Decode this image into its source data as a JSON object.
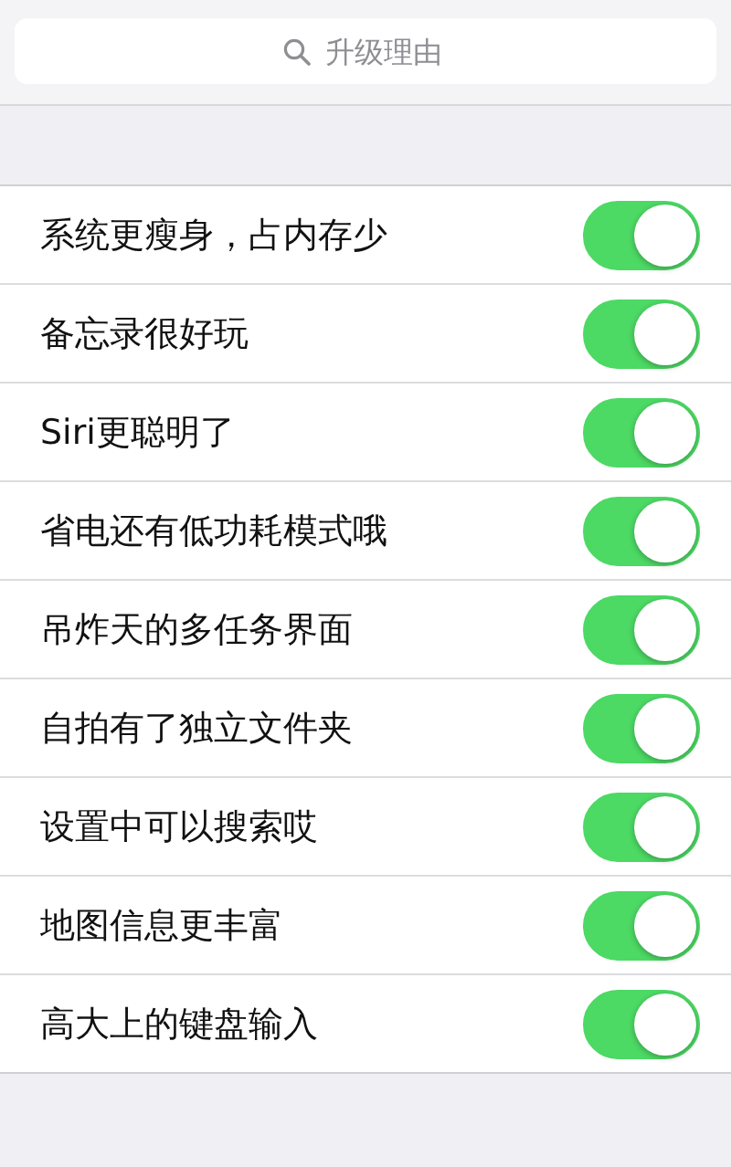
{
  "search": {
    "placeholder": "升级理由"
  },
  "items": [
    {
      "label": "系统更瘦身，占内存少",
      "on": true
    },
    {
      "label": "备忘录很好玩",
      "on": true
    },
    {
      "label": "Siri更聪明了",
      "on": true
    },
    {
      "label": "省电还有低功耗模式哦",
      "on": true
    },
    {
      "label": "吊炸天的多任务界面",
      "on": true
    },
    {
      "label": "自拍有了独立文件夹",
      "on": true
    },
    {
      "label": "设置中可以搜索哎",
      "on": true
    },
    {
      "label": "地图信息更丰富",
      "on": true
    },
    {
      "label": "高大上的键盘输入",
      "on": true
    }
  ]
}
